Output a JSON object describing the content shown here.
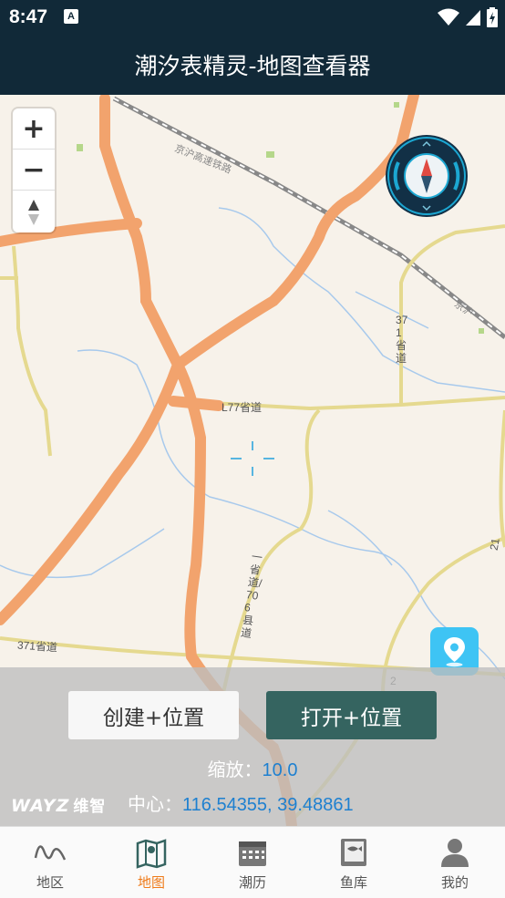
{
  "status_bar": {
    "time": "8:47",
    "notif_letter": "A"
  },
  "app_bar": {
    "title": "潮汐表精灵-地图查看器"
  },
  "map": {
    "zoom_in_label": "+",
    "zoom_out_label": "−",
    "labels": {
      "road_l77": "L77省道",
      "road_371": "371省道",
      "road_371_vertical": "371省道",
      "road_jiangsu": "京沪高速铁路",
      "road_vertical_a": "一 省道/706县道",
      "road_right_2": "2",
      "road_right_21": "21",
      "road_top_right": "京沪"
    }
  },
  "panel": {
    "create_label": "创建+位置",
    "open_label": "打开+位置",
    "zoom_label": "缩放：",
    "zoom_value": "10.0",
    "center_label": "中心：",
    "center_value": "116.54355, 39.48861",
    "logo_text": "WAYZ",
    "logo_cn": "维智"
  },
  "tabs": [
    {
      "label": "地区",
      "icon": "wave-icon",
      "active": false
    },
    {
      "label": "地图",
      "icon": "map-icon",
      "active": true
    },
    {
      "label": "潮历",
      "icon": "calendar-icon",
      "active": false
    },
    {
      "label": "鱼库",
      "icon": "fish-book-icon",
      "active": false
    },
    {
      "label": "我的",
      "icon": "user-icon",
      "active": false
    }
  ],
  "colors": {
    "header_bg": "#112938",
    "highway": "#f2a36d",
    "secondary_road": "#e5d98f",
    "open_button": "#356460",
    "accent_active": "#ef7b1a",
    "value_blue": "#1e80d0",
    "location_btn": "#3ec4f4"
  }
}
